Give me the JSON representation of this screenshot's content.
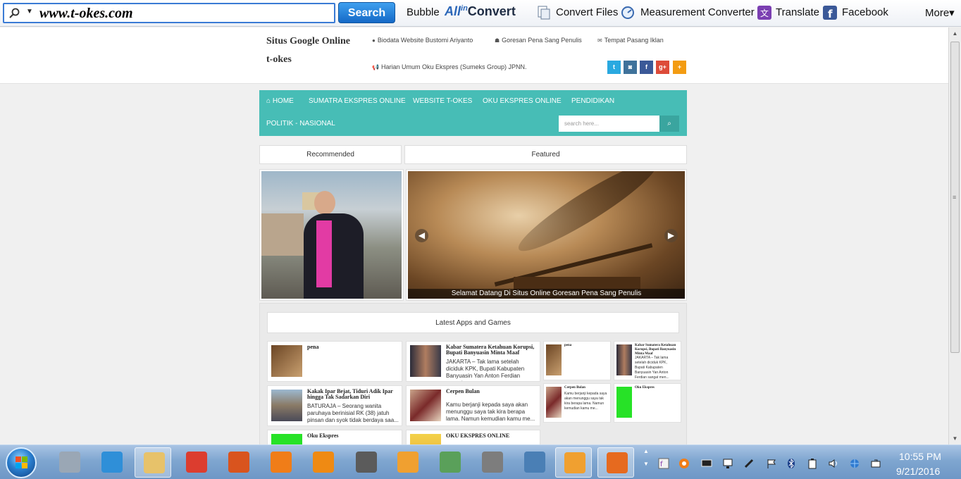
{
  "toolbar": {
    "url": "www.t-okes.com",
    "search_label": "Search",
    "bubble_label": "Bubble",
    "allin_label": {
      "all": "All",
      "in": "in",
      "convert": "Convert"
    },
    "convert_files_label": "Convert Files",
    "measurement_label": "Measurement Converter",
    "translate_label": "Translate",
    "facebook_label": "Facebook",
    "more_label": "More▾"
  },
  "header": {
    "title_line1": "Situs Google Online",
    "title_line2": "t-okes",
    "links": [
      {
        "icon": "user-icon",
        "label": "Biodata Website Bustomi Ariyanto"
      },
      {
        "icon": "sitemap-icon",
        "label": "Goresan Pena Sang Penulis"
      },
      {
        "icon": "envelope-icon",
        "label": "Tempat Pasang Iklan"
      },
      {
        "icon": "bullhorn-icon",
        "label": "Harian Umum Oku Ekspres (Sumeks Group) JPNN."
      }
    ],
    "social": [
      {
        "name": "twitter-icon",
        "glyph": "t",
        "color": "#2aa9e0"
      },
      {
        "name": "instagram-icon",
        "glyph": "◙",
        "color": "#3f729b"
      },
      {
        "name": "facebook-icon",
        "glyph": "f",
        "color": "#3b5998"
      },
      {
        "name": "google-plus-icon",
        "glyph": "g+",
        "color": "#dd4b39"
      },
      {
        "name": "plus-icon",
        "glyph": "+",
        "color": "#f39c12"
      }
    ]
  },
  "nav": {
    "items": [
      "HOME",
      "SUMATRA EKSPRES ONLINE",
      "WEBSITE T-OKES",
      "OKU EKSPRES ONLINE",
      "PENDIDIKAN",
      "POLITIK - NASIONAL"
    ],
    "search_placeholder": "search here..."
  },
  "tabs": {
    "recommended": "Recommended",
    "featured": "Featured"
  },
  "slider": {
    "caption": "Selamat Datang Di Situs Online Goresan Pena Sang Penulis"
  },
  "latest": {
    "title": "Latest Apps and Games",
    "posts": [
      {
        "title": "pena",
        "body": ""
      },
      {
        "title": "Kabar Sumatera Ketahuan Korupsi, Bupati Banyuasin Minta Maaf",
        "body": "JAKARTA – Tak lama setelah diciduk KPK, Bupati Kabupaten Banyuasin Yan Anton Ferdian sangat men..."
      },
      {
        "title": "Kakak Ipar Bejat, Tiduri Adik Ipar hingga Tak Sadarkan Diri",
        "body": "BATURAJA – Seorang wanita paruhaya berinisial RK (38) jatuh pinsan dan syok tidak berdaya saa..."
      },
      {
        "title": "Cerpen Bulan",
        "body": "Kamu berjanji kepada saya akan menunggu saya tak kira berapa lama. Namun kemudian kamu me..."
      },
      {
        "title": "Oku Ekspres",
        "body": ""
      },
      {
        "title": "OKU EKSPRES ONLINE",
        "body": ""
      }
    ],
    "small_posts": [
      {
        "title": "pena",
        "body": ""
      },
      {
        "title": "Kabar Sumatera Ketahuan Korupsi, Bupati Banyuasin Minta Maaf",
        "body": "JAKARTA – Tak lama setelah diciduk KPK, Bupati Kabupaten Banyuasin Yan Anton Ferdian sangat men..."
      },
      {
        "title": "Cerpen Bulan",
        "body": "Kamu berjanji kepada saya akan menunggu saya tak kira berapa lama. Namun kemudian kamu me..."
      },
      {
        "title": "Oku Ekspres",
        "body": ""
      }
    ]
  },
  "taskbar": {
    "apps": [
      {
        "name": "calculator-icon",
        "color": "#9aa7b5"
      },
      {
        "name": "internet-explorer-icon",
        "color": "#2f8fd8"
      },
      {
        "name": "file-explorer-icon",
        "color": "#e7c26a"
      },
      {
        "name": "chrome-icon",
        "color": "#dc3d2f"
      },
      {
        "name": "presentation-app-icon",
        "color": "#d9541e"
      },
      {
        "name": "avast-icon",
        "color": "#f07d18"
      },
      {
        "name": "vlc-icon",
        "color": "#ef8a13"
      },
      {
        "name": "crosshair-app-icon",
        "color": "#5b5b5b"
      },
      {
        "name": "media-player-icon",
        "color": "#f0a030"
      },
      {
        "name": "download-manager-icon",
        "color": "#5aa05a"
      },
      {
        "name": "photoscape-icon",
        "color": "#7d7d7d"
      },
      {
        "name": "network-monitor-icon",
        "color": "#4a7fb5"
      },
      {
        "name": "media-player-2-icon",
        "color": "#f0a030"
      },
      {
        "name": "firefox-icon",
        "color": "#e66a1f"
      }
    ],
    "time": "10:55 PM",
    "date": "9/21/2016"
  },
  "colors": {
    "nav_bg": "#47bdb6",
    "search_button": "#1a73d0",
    "taskbar": "#7fa6d0"
  }
}
